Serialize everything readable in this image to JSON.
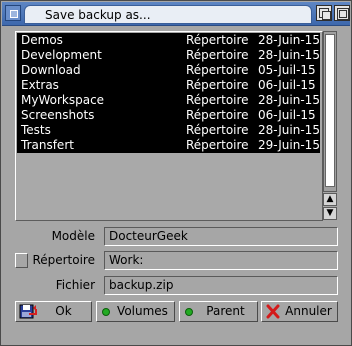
{
  "window": {
    "title": "Save backup as..."
  },
  "files": [
    {
      "name": "Demos",
      "type": "Répertoire",
      "date": "28-Juin-15"
    },
    {
      "name": "Development",
      "type": "Répertoire",
      "date": "28-Juin-15"
    },
    {
      "name": "Download",
      "type": "Répertoire",
      "date": "05-Juil-15"
    },
    {
      "name": "Extras",
      "type": "Répertoire",
      "date": "06-Juil-15"
    },
    {
      "name": "MyWorkspace",
      "type": "Répertoire",
      "date": "28-Juin-15"
    },
    {
      "name": "Screenshots",
      "type": "Répertoire",
      "date": "06-Juil-15"
    },
    {
      "name": "Tests",
      "type": "Répertoire",
      "date": "28-Juin-15"
    },
    {
      "name": "Transfert",
      "type": "Répertoire",
      "date": "29-Juin-15"
    }
  ],
  "scroll": {
    "up_glyph": "▲",
    "down_glyph": "▼"
  },
  "form": {
    "model_label": "Modèle",
    "model_value": "DocteurGeek",
    "dir_label": "Répertoire",
    "dir_value": "Work:",
    "file_label": "Fichier",
    "file_value": "backup.zip"
  },
  "buttons": {
    "ok": "Ok",
    "volumes": "Volumes",
    "parent": "Parent",
    "cancel": "Annuler"
  },
  "colors": {
    "title_bar": "#4a74b8",
    "list_bg": "#000000",
    "list_text": "#ffffff",
    "led": "#22aa22",
    "window_bg": "#a6a6a6"
  }
}
